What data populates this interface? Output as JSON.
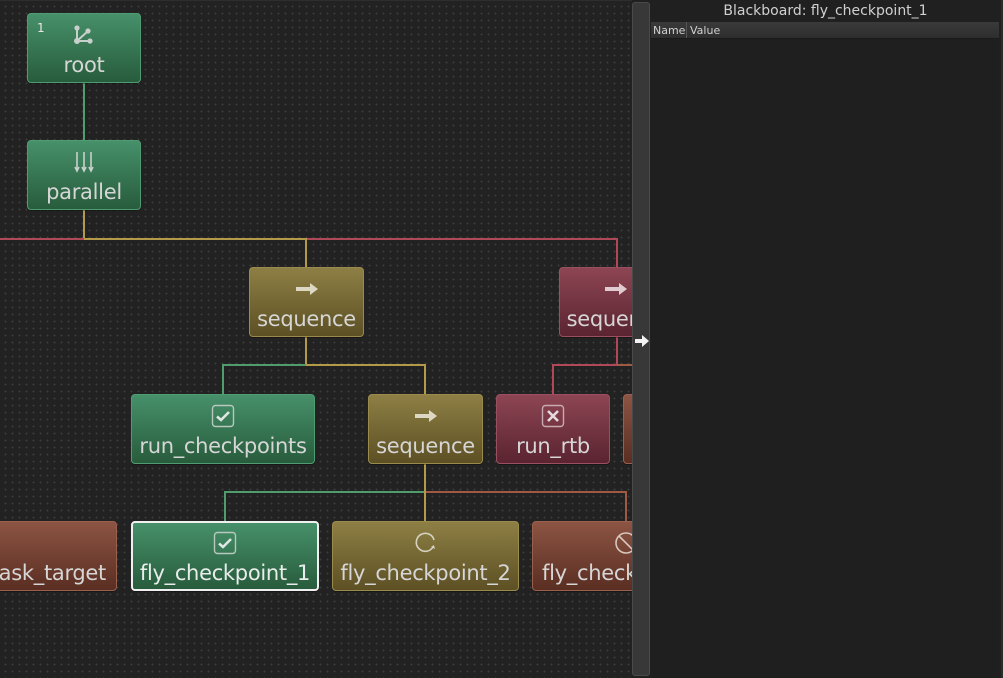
{
  "colors": {
    "success": "#2f6b47",
    "running": "#6f6232",
    "failure": "#6f303c",
    "invalid": "#6f3e30",
    "wire_green": "#4f9c6c",
    "wire_yellow": "#b39a48",
    "wire_red": "#b0485a",
    "wire_brown": "#a05a44"
  },
  "tree": {
    "nodes": [
      {
        "id": "root",
        "label": "root",
        "type": "root",
        "status": "success",
        "icon": "root-icon",
        "badge": "1"
      },
      {
        "id": "parallel",
        "label": "parallel",
        "type": "parallel",
        "status": "success",
        "icon": "parallel-arrows-icon"
      },
      {
        "id": "sequence-1",
        "label": "sequence",
        "type": "sequence",
        "status": "running",
        "icon": "arrow-right-icon"
      },
      {
        "id": "sequence-2",
        "label": "sequence",
        "type": "sequence",
        "status": "failure",
        "icon": "arrow-right-icon"
      },
      {
        "id": "run-checkpoints",
        "label": "run_checkpoints",
        "type": "action",
        "status": "success",
        "icon": "checkbox-checked-icon"
      },
      {
        "id": "sequence-3",
        "label": "sequence",
        "type": "sequence",
        "status": "running",
        "icon": "arrow-right-icon"
      },
      {
        "id": "run-rtb",
        "label": "run_rtb",
        "type": "action",
        "status": "failure",
        "icon": "checkbox-x-icon"
      },
      {
        "id": "partial-node",
        "label": "",
        "type": "action",
        "status": "invalid",
        "icon": ""
      },
      {
        "id": "task-target",
        "label": "task_target",
        "type": "action",
        "status": "invalid",
        "icon": ""
      },
      {
        "id": "fly-checkpoint-1",
        "label": "fly_checkpoint_1",
        "type": "action",
        "status": "success",
        "icon": "checkbox-checked-icon",
        "selected": true
      },
      {
        "id": "fly-checkpoint-2",
        "label": "fly_checkpoint_2",
        "type": "action",
        "status": "running",
        "icon": "running-circle-icon"
      },
      {
        "id": "fly-checkpoint-3",
        "label": "fly_check",
        "type": "action",
        "status": "invalid",
        "icon": "prohibited-icon"
      }
    ]
  },
  "panel": {
    "title": "Blackboard: fly_checkpoint_1",
    "columns": [
      "Name",
      "Value"
    ],
    "rows": []
  },
  "splitter": {
    "icon": "arrow-right-icon"
  }
}
